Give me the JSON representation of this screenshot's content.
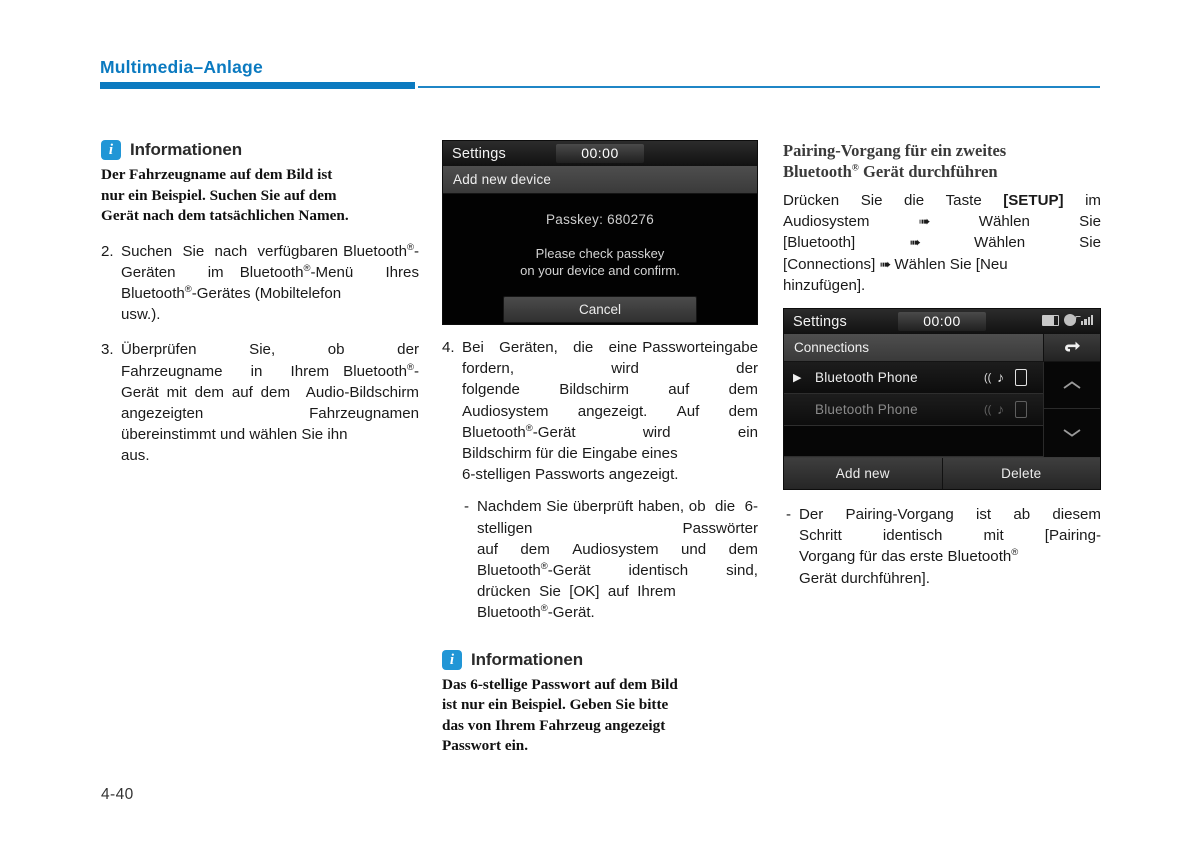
{
  "header": {
    "title": "Multimedia–Anlage",
    "accent_color": "#0b7ac0"
  },
  "page_number": "4-40",
  "left_column": {
    "info_note": {
      "icon": "info-icon",
      "icon_glyph": "i",
      "title": "Informationen",
      "lines": [
        "Der Fahrzeugname auf dem Bild ist",
        "nur ein Beispiel. Suchen Sie auf dem",
        "Gerät nach dem tatsächlichen Namen."
      ]
    },
    "steps": [
      {
        "marker": "2.",
        "lines": [
          "Suchen Sie nach verfügbaren",
          "Bluetooth®-Geräten im",
          "Bluetooth®-Menü Ihres",
          "Bluetooth®-Gerätes (Mobiltelefon",
          "usw.)."
        ]
      },
      {
        "marker": "3.",
        "lines": [
          "Überprüfen Sie, ob der",
          "Fahrzeugname in Ihrem",
          "Bluetooth®-Gerät mit dem auf",
          "dem Audio-Bildschirm",
          "angezeigten Fahrzeugnamen",
          "übereinstimmt und wählen Sie ihn",
          "aus."
        ]
      }
    ]
  },
  "middle_column": {
    "device_screen": {
      "status_bar": {
        "title": "Settings",
        "clock": "00:00"
      },
      "sub_bar": {
        "label": "Add new device"
      },
      "passkey_label": "Passkey: 680276",
      "hint_line1": "Please check passkey",
      "hint_line2": "on your device and confirm.",
      "cancel_button": "Cancel"
    },
    "steps": [
      {
        "marker": "4.",
        "lines": [
          "Bei Geräten, die eine",
          "Passworteingabe fordern, wird der",
          "folgende Bildschirm auf dem",
          "Audiosystem angezeigt. Auf dem",
          "Bluetooth®-Gerät wird ein",
          "Bildschirm für die Eingabe eines",
          "6-stelligen Passworts angezeigt."
        ]
      }
    ],
    "sub_items": [
      {
        "marker": "-",
        "lines": [
          "Nachdem Sie überprüft haben,",
          "ob die 6-stelligen Passwörter",
          "auf dem Audiosystem und dem",
          "Bluetooth®-Gerät identisch sind,",
          "drücken Sie [OK] auf Ihrem",
          "Bluetooth®-Gerät."
        ]
      }
    ],
    "info_note": {
      "icon": "info-icon",
      "icon_glyph": "i",
      "title": "Informationen",
      "lines": [
        "Das 6-stellige Passwort auf dem Bild",
        "ist nur ein Beispiel. Geben Sie bitte",
        "das von Ihrem Fahrzeug angezeigt",
        "Passwort ein."
      ]
    }
  },
  "right_column": {
    "section_heading": {
      "line1": "Pairing-Vorgang für ein zweites",
      "line2_pre": "Bluetooth",
      "line2_sup": "®",
      "line2_post": " Gerät durchführen"
    },
    "intro_paragraph": {
      "line1_pre": "Drücken Sie die Taste ",
      "line1_bold": "[SETUP]",
      "line1_post": " im",
      "line2": "Audiosystem",
      "arrow": "➠",
      "line2_post": "Wählen Sie",
      "line3": "[Bluetooth]",
      "line3_post": "Wählen Sie",
      "line4": "[Connections]",
      "line4_post": "Wählen Sie [Neu",
      "line5": "hinzufügen]."
    },
    "device_screen": {
      "status_bar": {
        "title": "Settings",
        "clock": "00:00",
        "icons": [
          "battery-icon",
          "bluetooth-audio-icon",
          "signal-bars-icon"
        ]
      },
      "sub_bar": {
        "label": "Connections",
        "back_button": "back-arrow-icon"
      },
      "rows": [
        {
          "caret": "▶",
          "name": "Bluetooth Phone",
          "icons": [
            "audio-streaming-icon",
            "phone-icon"
          ],
          "dimmed": false
        },
        {
          "caret": "",
          "name": "Bluetooth Phone",
          "icons": [
            "audio-streaming-icon",
            "phone-icon"
          ],
          "dimmed": true
        },
        {
          "caret": "",
          "name": "",
          "icons": [],
          "dimmed": true
        }
      ],
      "scroll_up": "chevron-up-icon",
      "scroll_down": "chevron-down-icon",
      "footer_buttons": [
        "Add new",
        "Delete"
      ]
    },
    "sub_items": [
      {
        "marker": "-",
        "lines": [
          "Der Pairing-Vorgang ist ab diesem",
          "Schritt identisch mit [Pairing-",
          "Vorgang für das erste Bluetooth®",
          "Gerät durchführen]."
        ]
      }
    ]
  }
}
